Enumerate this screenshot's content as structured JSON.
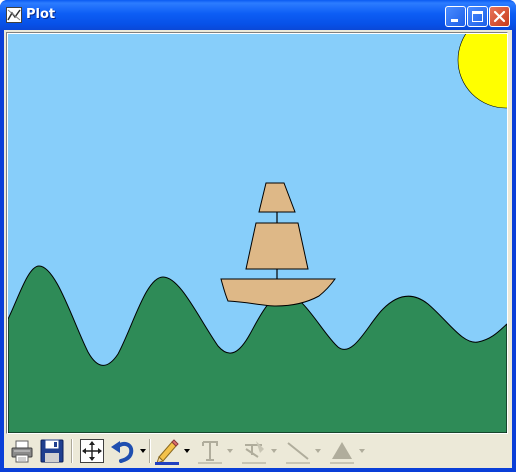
{
  "window": {
    "title": "Plot",
    "app_icon": "plot-app-icon",
    "controls": [
      "minimize-icon",
      "maximize-icon",
      "close-icon"
    ],
    "title_bar_color": "#0a5bf2"
  },
  "scene": {
    "sky_color": "#87cefa",
    "sun_color": "#ffff00",
    "hills_color": "#2e8b57",
    "ship_color": "#deb887",
    "outline_color": "#000000"
  },
  "toolbar": {
    "items": [
      {
        "icon": "print-icon",
        "enabled": true
      },
      {
        "icon": "save-icon",
        "enabled": true
      },
      {
        "icon": "pan-zoom-icon",
        "enabled": true
      },
      {
        "icon": "undo-icon",
        "enabled": true,
        "has_dropdown": true
      },
      {
        "icon": "pencil-icon",
        "enabled": true,
        "has_dropdown": true
      },
      {
        "icon": "text-icon",
        "enabled": false,
        "has_dropdown": true
      },
      {
        "icon": "line-style-icon",
        "enabled": false,
        "has_dropdown": true
      },
      {
        "icon": "line-icon",
        "enabled": false,
        "has_dropdown": true
      },
      {
        "icon": "fill-icon",
        "enabled": false,
        "has_dropdown": true
      }
    ]
  }
}
